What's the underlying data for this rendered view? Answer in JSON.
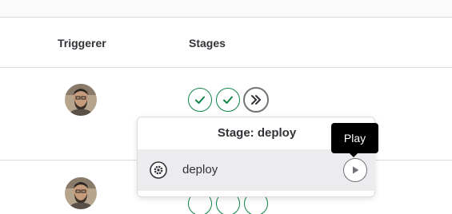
{
  "table": {
    "columns": [
      "Triggerer",
      "Stages"
    ]
  },
  "rows": [
    {
      "triggerer": "avatar",
      "stages": [
        "success",
        "success",
        "manual"
      ]
    },
    {
      "triggerer": "avatar",
      "stages": [
        "success",
        "success",
        "success"
      ]
    }
  ],
  "popover": {
    "title": "Stage: deploy",
    "job": {
      "name": "deploy",
      "status_icon": "gear-icon",
      "action_icon": "play-icon"
    }
  },
  "tooltip": {
    "text": "Play"
  },
  "colors": {
    "success": "#108548",
    "manual": "#737278",
    "tooltip_bg": "#000000"
  }
}
